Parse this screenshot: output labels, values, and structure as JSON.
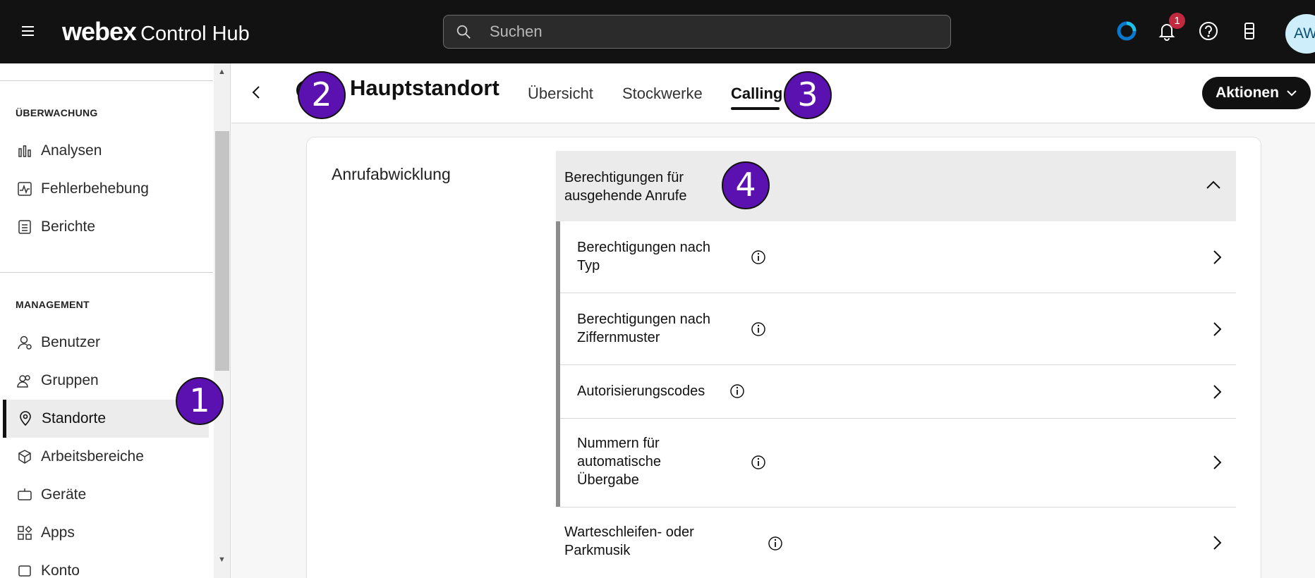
{
  "topbar": {
    "brand": "webex",
    "product": "Control Hub",
    "search_placeholder": "Suchen",
    "notification_count": "1",
    "avatar_initials": "AW",
    "icons": [
      "menu-icon",
      "webex-status-icon",
      "bell-icon",
      "help-icon",
      "device-icon"
    ]
  },
  "sidebar": {
    "sections": [
      {
        "title": "ÜBERWACHUNG",
        "items": [
          {
            "label": "Analysen",
            "icon": "analytics-icon"
          },
          {
            "label": "Fehlerbehebung",
            "icon": "troubleshooting-icon"
          },
          {
            "label": "Berichte",
            "icon": "reports-icon"
          }
        ]
      },
      {
        "title": "MANAGEMENT",
        "items": [
          {
            "label": "Benutzer",
            "icon": "user-icon"
          },
          {
            "label": "Gruppen",
            "icon": "groups-icon"
          },
          {
            "label": "Standorte",
            "icon": "location-pin-icon",
            "active": true
          },
          {
            "label": "Arbeitsbereiche",
            "icon": "workspaces-icon"
          },
          {
            "label": "Geräte",
            "icon": "devices-icon"
          },
          {
            "label": "Apps",
            "icon": "apps-icon"
          },
          {
            "label": "Konto",
            "icon": "account-icon"
          }
        ]
      }
    ]
  },
  "header": {
    "title": "Hauptstandort",
    "tabs": [
      {
        "label": "Übersicht"
      },
      {
        "label": "Stockwerke"
      },
      {
        "label": "Calling",
        "active": true
      }
    ],
    "actions_label": "Aktionen"
  },
  "content": {
    "section_title": "Anrufabwicklung",
    "accordion": {
      "label": "Berechtigungen für ausgehende Anrufe",
      "expanded": true,
      "rows": [
        {
          "label": "Berechtigungen nach Typ"
        },
        {
          "label": "Berechtigungen nach Ziffernmuster"
        },
        {
          "label": "Autorisierungscodes"
        },
        {
          "label": "Nummern für automatische Übergabe"
        }
      ]
    },
    "next_row": {
      "label": "Warteschleifen- oder Parkmusik"
    }
  },
  "markers": [
    "1",
    "2",
    "3",
    "4"
  ],
  "colors": {
    "topbar": "#121212",
    "marker": "#5b10b0",
    "accent": "#0a78cc",
    "badge": "#c0293e"
  }
}
